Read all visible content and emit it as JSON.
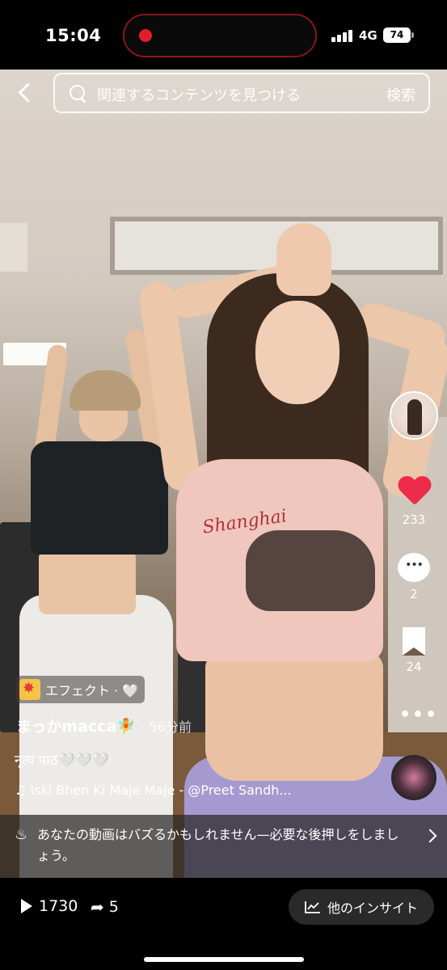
{
  "status_bar": {
    "time": "15:04",
    "network": "4G",
    "battery": "74"
  },
  "search": {
    "placeholder": "関連するコンテンツを見つける",
    "button": "検索"
  },
  "right_rail": {
    "likes": "233",
    "comments": "2",
    "saves": "24",
    "like_color": "#ee2b4a"
  },
  "video_print_text": "Shanghai",
  "post": {
    "effect_label": "エフェクト · 🤍",
    "username": "まっかmacca🧚",
    "time_ago": "· 56分前",
    "caption": "नृत्य पाठ🤍🤍🤍",
    "music": "♫ Iski Bhen Ki Maje Maje - @Preet Sandh..."
  },
  "buzz_banner": {
    "icon": "fire-icon",
    "text": "あなたの動画はバズるかもしれません—必要な後押しをしましょう。"
  },
  "bottom_bar": {
    "views": "1730",
    "shares": "5",
    "insight_label": "他のインサイト"
  }
}
